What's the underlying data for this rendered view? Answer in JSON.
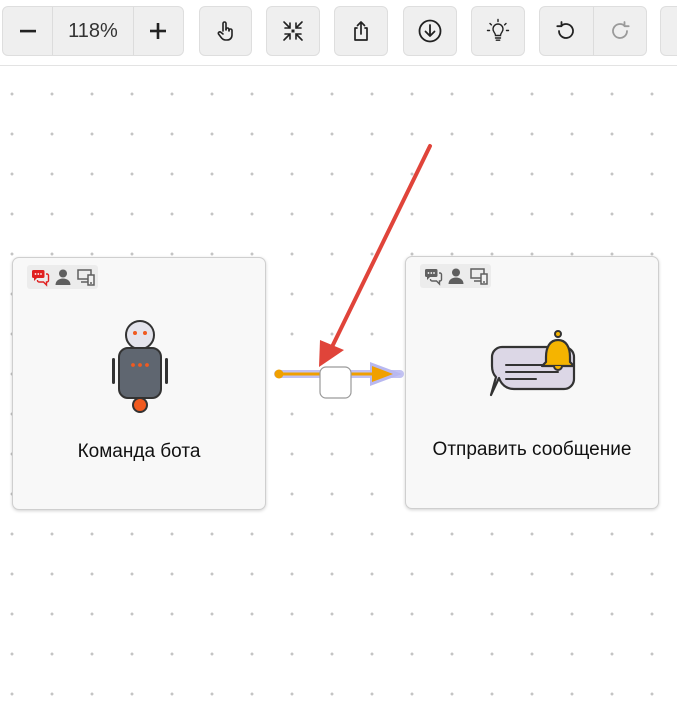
{
  "toolbar": {
    "zoom_minus_label": "−",
    "zoom_value": "118%",
    "zoom_plus_label": "+",
    "tools": [
      {
        "name": "pan",
        "icon": "hand-pointer-icon"
      },
      {
        "name": "fit",
        "icon": "collapse-arrows-icon"
      },
      {
        "name": "export",
        "icon": "share-upload-icon"
      },
      {
        "name": "download",
        "icon": "download-circle-icon"
      },
      {
        "name": "hint",
        "icon": "lightbulb-icon"
      }
    ],
    "undo_icon": "undo-icon",
    "redo_icon": "redo-icon"
  },
  "nodes": [
    {
      "title": "Команда бота",
      "icon": "robot-icon",
      "header_icons": [
        "chat-bubbles-icon",
        "user-icon",
        "devices-icon"
      ],
      "chat_icon_active": true
    },
    {
      "title": "Отправить сообщение",
      "icon": "message-bell-icon",
      "header_icons": [
        "chat-bubbles-icon",
        "user-icon",
        "devices-icon"
      ],
      "chat_icon_active": false
    }
  ],
  "colors": {
    "connector": "#f0a000",
    "connector_halo": "#b8b8f0",
    "annotation_arrow": "#e0443a",
    "active_chat_icon": "#e02020",
    "node_bg": "#f8f8f8",
    "toolbar_button_bg": "#efefef"
  }
}
